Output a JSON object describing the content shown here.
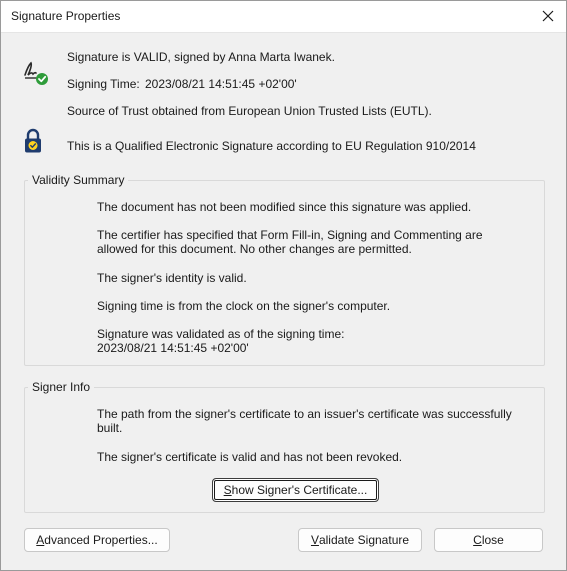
{
  "window": {
    "title": "Signature Properties"
  },
  "status": {
    "valid_line": "Signature is VALID, signed by Anna Marta Iwanek.",
    "signing_time_label": "Signing Time:",
    "signing_time_value": "2023/08/21 14:51:45 +02'00'",
    "trust_source": "Source of Trust obtained from European Union Trusted Lists (EUTL).",
    "qualified_line": "This is a Qualified Electronic Signature according to EU Regulation 910/2014"
  },
  "validity_summary": {
    "legend": "Validity Summary",
    "items": [
      "The document has not been modified since this signature was applied.",
      "The certifier has specified that Form Fill-in, Signing and Commenting are\nallowed for this document. No other changes are permitted.",
      "The signer's identity is valid.",
      "Signing time is from the clock on the signer's computer.",
      "Signature was validated as of the signing time:\n2023/08/21 14:51:45 +02'00'"
    ]
  },
  "signer_info": {
    "legend": "Signer Info",
    "items": [
      "The path from the signer's certificate to an issuer's certificate was successfully\nbuilt.",
      "The signer's certificate is valid and has not been revoked."
    ],
    "show_certificate": {
      "mnemonic": "S",
      "rest": "how Signer's Certificate..."
    }
  },
  "buttons": {
    "advanced": {
      "mnemonic": "A",
      "rest": "dvanced Properties..."
    },
    "validate": {
      "mnemonic": "V",
      "rest": "alidate Signature"
    },
    "close": {
      "mnemonic": "C",
      "rest": "lose"
    }
  },
  "colors": {
    "check_green": "#2e9c3a",
    "lock_navy": "#1f3c6e",
    "focus_border": "#1a1a1a"
  },
  "icons": {
    "signature": "signature-valid-icon",
    "lock": "qualified-lock-icon",
    "close": "close-icon"
  }
}
